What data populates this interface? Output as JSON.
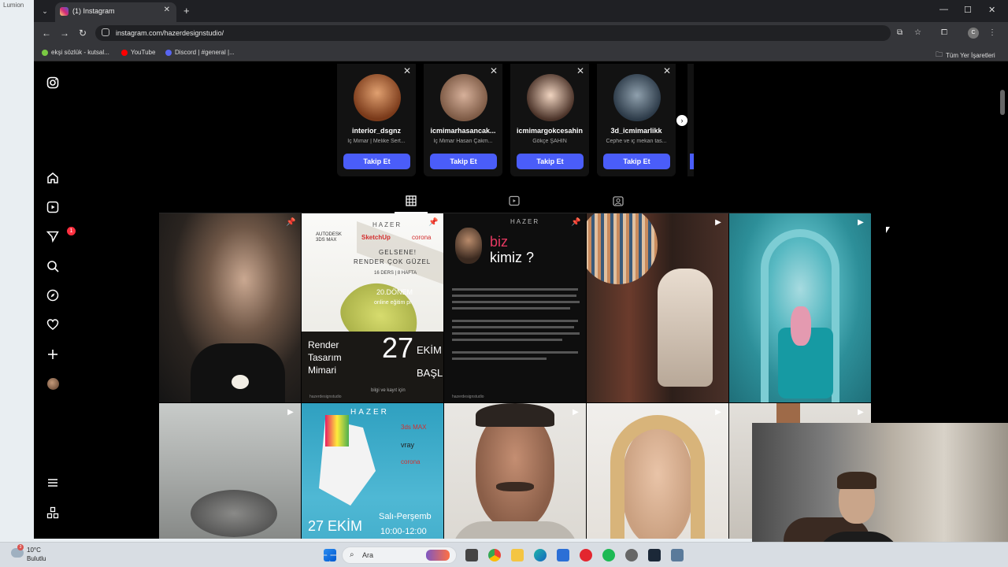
{
  "desktop": {
    "left_label": "Lumion"
  },
  "browser": {
    "tab_title": "(1) Instagram",
    "url": "instagram.com/hazerdesignstudio/",
    "bookmarks": [
      {
        "label": "ekşi sözlük - kutsal...",
        "color": "#7ac943"
      },
      {
        "label": "YouTube",
        "color": "#ff0000"
      },
      {
        "label": "Discord | #general |...",
        "color": "#5865f2"
      }
    ],
    "bookmarks_folder": "Tüm Yer İşaretleri",
    "profile_initial": "C"
  },
  "sidebar": {
    "notification_count": "1"
  },
  "suggestions": [
    {
      "username": "interior_dsgnz",
      "subtitle": "İç Mimar | Melike Sert...",
      "button": "Takip Et",
      "avatar_color": "#b56a3e"
    },
    {
      "username": "icmimarhasancak...",
      "subtitle": "İç Mimar Hasan Çakm...",
      "button": "Takip Et",
      "avatar_color": "#a57e64"
    },
    {
      "username": "icmimargokcesahin",
      "subtitle": "Gökçe ŞAHİN",
      "button": "Takip Et",
      "avatar_color": "#caa58e"
    },
    {
      "username": "3d_icmimarlikk",
      "subtitle": "Cephe ve iç mekan tas...",
      "button": "Takip Et",
      "avatar_color": "#4d5a6b"
    }
  ],
  "posts": [
    {
      "name": "post-portrait",
      "badge": "pinned"
    },
    {
      "name": "post-render-course",
      "badge": "pinned",
      "t1": "AUTODESK",
      "t2": "3DS MAX",
      "t3": "SketchUp",
      "t4": "corona",
      "t5": "HAZER",
      "t6": "GELSENE!",
      "t7": "RENDER ÇOK GÜZEL",
      "t8": "16 DERS | 8 HAFTA",
      "t9": "20.DÖNEM",
      "t10": "online eğitim pr",
      "t11": "Render",
      "t12": "Tasarım",
      "t13": "Mimari",
      "t14": "27",
      "t15": "EKİM",
      "t16": "BAŞL",
      "t17": "bilgi ve kayıt için",
      "t18": "hazerdesignstudio"
    },
    {
      "name": "post-who-are-we",
      "badge": "pinned",
      "t1": "HAZER",
      "t2": "biz",
      "t3": "kimiz ?",
      "t4": "hazerdesignstudio"
    },
    {
      "name": "post-woman-chair",
      "badge": "reel"
    },
    {
      "name": "post-child-chair",
      "badge": "reel"
    },
    {
      "name": "post-outdoor-lamp",
      "badge": "reel"
    },
    {
      "name": "post-unicorn-course",
      "badge": "reel",
      "t1": "HAZER",
      "t2": "3ds MAX",
      "t3": "vray",
      "t4": "corona",
      "t5": "27 EKİM",
      "t6": "Salı-Perşemb",
      "t7": "10:00-12:00"
    },
    {
      "name": "post-man-mustache",
      "badge": "reel"
    },
    {
      "name": "post-woman-blonde",
      "badge": "reel"
    },
    {
      "name": "post-interior-partial",
      "badge": "reel"
    }
  ],
  "taskbar": {
    "weather_temp": "10°C",
    "weather_cond": "Bulutlu",
    "weather_badge": "3",
    "search_placeholder": "Ara"
  }
}
